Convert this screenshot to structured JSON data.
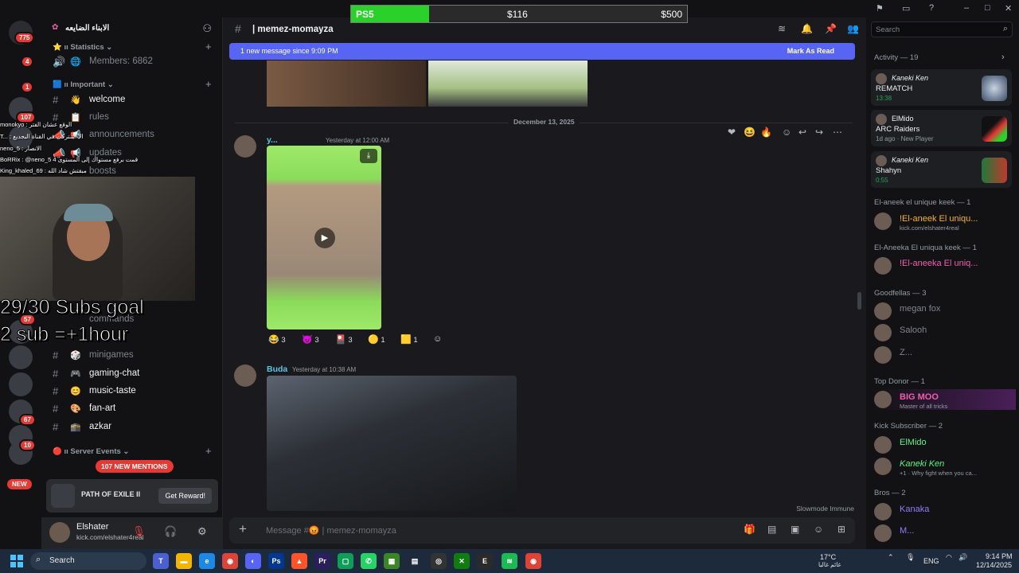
{
  "overlay": {
    "progress": {
      "label": "PS5",
      "current": "$116",
      "target": "$500",
      "fraction": 0.232
    },
    "goal_line1": "29/30 Subs goal",
    "goal_line2": "2 sub =+1hour",
    "chat_lines": [
      "monokyo : الوقع عشان الفتر",
      "T... : الا اشتركت في القناة البجديع",
      "neno_5 : الانصار",
      "BoRRix : @neno_5 4 قمت برفع مستواك إلى المستوى",
      "King_khaled_69 : مبقتش شاد الله"
    ]
  },
  "rail": {
    "badges": [
      "775",
      "4",
      "1",
      "107",
      "57",
      "67",
      "10"
    ],
    "new_label": "NEW"
  },
  "sidebar": {
    "guild_name": "الابناء الضايعه",
    "categories": {
      "statistics": "Statistics",
      "important": "Important",
      "server_events": "Server Events"
    },
    "channels": {
      "members": "Members: 6862",
      "welcome": "welcome",
      "rules": "rules",
      "announcements": "announcements",
      "updates": "updates",
      "boosts": "boosts",
      "commands": "commands",
      "minigames": "minigames",
      "gaming_chat": "gaming-chat",
      "music_taste": "music-taste",
      "fan_art": "fan-art",
      "azkar": "azkar"
    },
    "mentions": "107 NEW MENTIONS",
    "promo": {
      "title": "PATH OF EXILE II",
      "button": "Get Reward!"
    },
    "user": {
      "name": "Elshater",
      "status": "kick.com/elshater4real"
    }
  },
  "channel": {
    "name": "| memez-momayza",
    "new_message_banner": "1 new message since 9:09 PM",
    "mark_as_read": "Mark As Read",
    "date_divider": "December 13, 2025",
    "messages": [
      {
        "author": "y...",
        "timestamp": "Yesterday at 12:00 AM",
        "reactions": [
          "3",
          "3",
          "3",
          "1",
          "1"
        ]
      },
      {
        "author": "Buda",
        "timestamp": "Yesterday at 10:38 AM"
      }
    ],
    "slowmode": "Slowmode Immune",
    "composer_placeholder": "Message #😡 | memez-momayza"
  },
  "members": {
    "search_placeholder": "Search",
    "activity_title": "Activity — 19",
    "activities": [
      {
        "name": "Kaneki Ken",
        "game": "REMATCH",
        "status": "13:38"
      },
      {
        "name": "ElMido",
        "game": "ARC Raiders",
        "status": "1d ago · New Player"
      },
      {
        "name": "Kaneki Ken",
        "game": "Shahyn",
        "status": "0:55"
      }
    ],
    "groups": [
      {
        "title": "El-aneek el unique keek — 1",
        "members": [
          {
            "name": "!El-aneek El uniqu...",
            "sub": "kick.com/elshater4real",
            "color": "#f0b232"
          }
        ]
      },
      {
        "title": "El-Aneeka El uniqua keek — 1",
        "members": [
          {
            "name": "!El-aneeka El uniq...",
            "sub": "",
            "color": "#f15dae"
          }
        ]
      },
      {
        "title": "Goodfellas — 3",
        "members": [
          {
            "name": "megan fox",
            "sub": "",
            "color": "#80848e"
          },
          {
            "name": "Salooh",
            "sub": "",
            "color": "#80848e"
          },
          {
            "name": "Z...",
            "sub": "",
            "color": "#80848e"
          }
        ]
      },
      {
        "title": "Top Donor — 1",
        "members": [
          {
            "name": "BIG MOO",
            "sub": "Master of all tricks",
            "color": "#f15dae"
          }
        ]
      },
      {
        "title": "Kick Subscriber — 2",
        "members": [
          {
            "name": "ElMido",
            "sub": "",
            "color": "#57f287"
          },
          {
            "name": "Kaneki Ken",
            "sub": "+1 · Why fight when you ca...",
            "color": "#57f287"
          }
        ]
      },
      {
        "title": "Bros — 2",
        "members": [
          {
            "name": "Kanaka",
            "sub": "",
            "color": "#8e7dff"
          },
          {
            "name": "M...",
            "sub": "",
            "color": "#8e7dff"
          }
        ]
      }
    ]
  },
  "taskbar": {
    "search": "Search",
    "weather": "17°C",
    "weather_sub": "غائم غالبا",
    "lang": "ENG",
    "time": "9:14 PM",
    "date": "12/14/2025"
  }
}
